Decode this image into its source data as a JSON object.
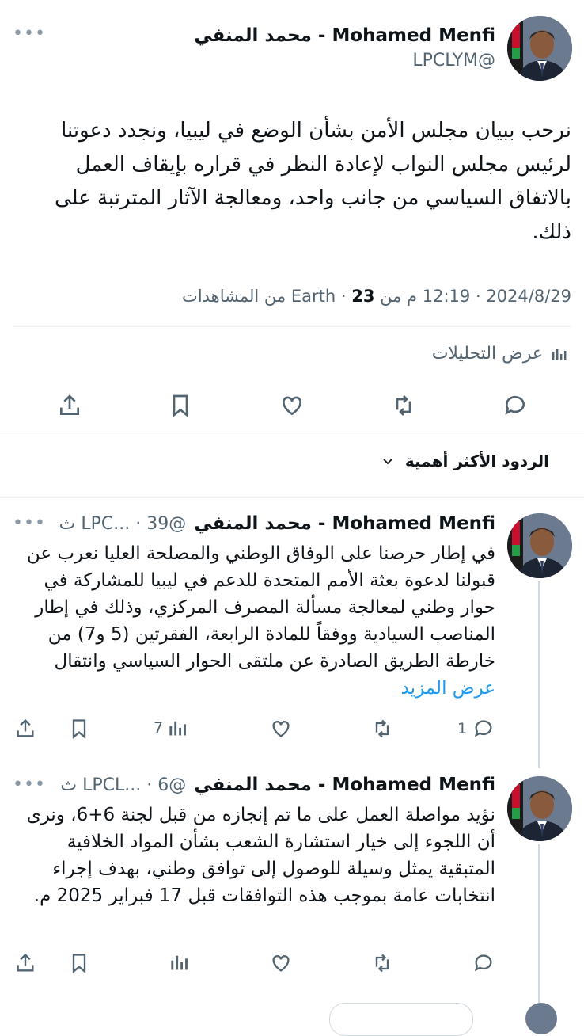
{
  "main_tweet": {
    "author_name": "Mohamed Menfi - محمد المنفي",
    "handle": "@LPCLYM",
    "text": "نرحب ببيان مجلس الأمن بشأن الوضع في ليبيا، ونجدد دعوتنا لرئيس مجلس النواب لإعادة النظر في قراره بإيقاف العمل بالاتفاق السياسي من جانب واحد، ومعالجة الآثار المترتبة على ذلك.",
    "date": "2024/8/29",
    "time": "12:19 م من Earth",
    "views_count": "23",
    "views_label": "من المشاهدات",
    "analytics_label": "عرض التحليلات"
  },
  "replies_sort": {
    "label": "الردود الأكثر أهمية"
  },
  "replies": [
    {
      "author_name": "Mohamed Menfi - محمد المنفي",
      "handle_time": "@LPC... · 39 ث",
      "text": "في إطار حرصنا على الوفاق الوطني والمصلحة العليا نعرب عن قبولنا لدعوة بعثة الأمم المتحدة للدعم في ليبيا للمشاركة في حوار وطني لمعالجة مسألة المصرف المركزي، وذلك في إطار المناصب السيادية ووفقاً للمادة الرابعة، الفقرتين (5 و7) من خارطة الطريق الصادرة عن ملتقى الحوار السياسي وانتقال",
      "show_more": "عرض المزيد",
      "reply_count": "1",
      "views_count": "7"
    },
    {
      "author_name": "Mohamed Menfi - محمد المنفي",
      "handle_time": "@LPCL... · 6 ث",
      "text": "نؤيد مواصلة العمل على ما تم إنجازه من قبل لجنة 6+6، ونرى أن اللجوء إلى خيار استشارة الشعب بشأن المواد الخلافية المتبقية يمثل وسيلة للوصول إلى توافق وطني، بهدف إجراء انتخابات عامة بموجب هذه التوافقات قبل 17 فبراير 2025 م.",
      "show_more": "",
      "reply_count": "",
      "views_count": ""
    }
  ],
  "colors": {
    "accent": "#1d9bf0",
    "text": "#0f1419",
    "secondary": "#536471"
  }
}
